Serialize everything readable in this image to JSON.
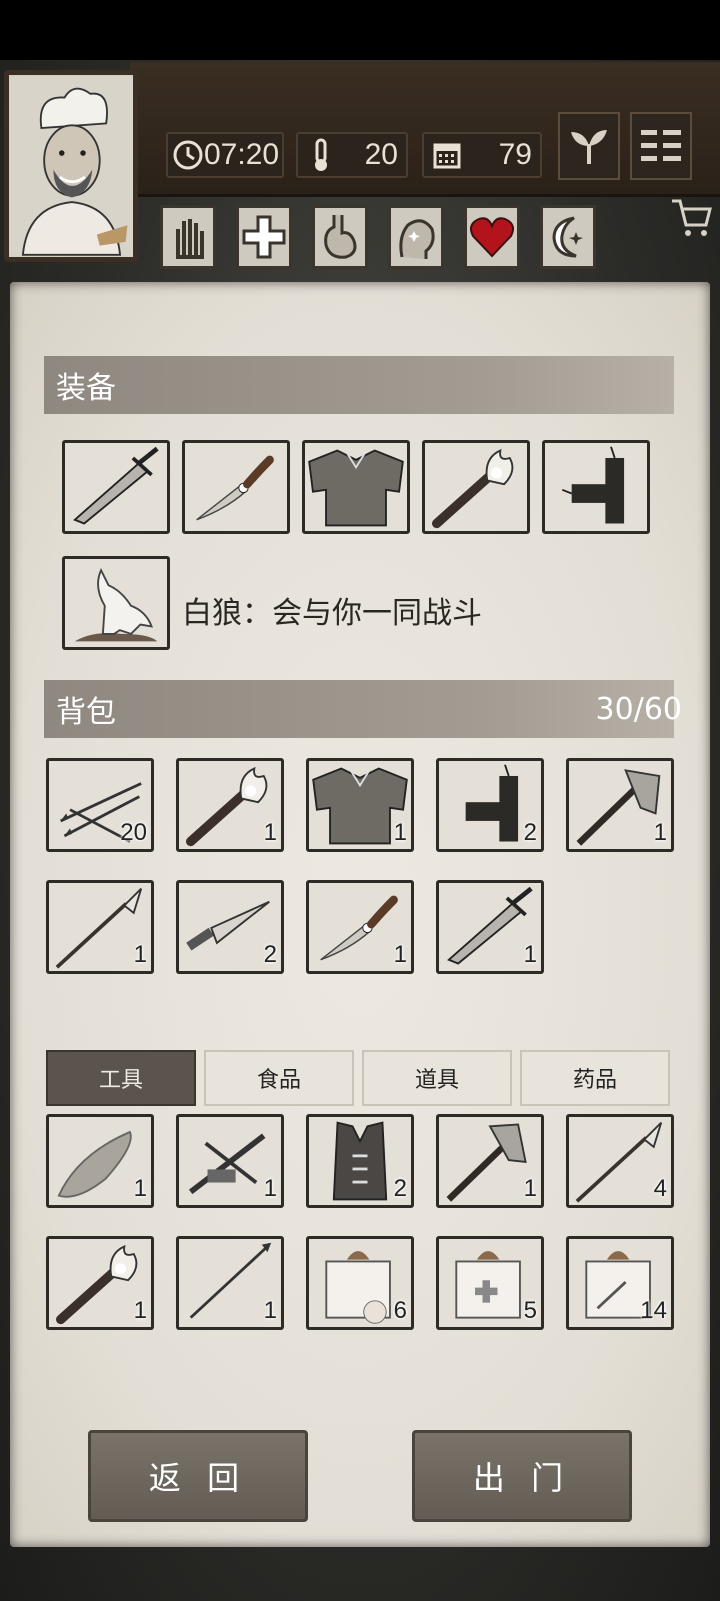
{
  "hud": {
    "time": "07:20",
    "temperature": "20",
    "day": "79",
    "icons": [
      "clock-icon",
      "thermometer-icon",
      "calendar-icon"
    ],
    "actions": [
      "sprout-icon",
      "menu-icon"
    ],
    "status_buttons": [
      "hand-icon",
      "cross-icon",
      "stomach-icon",
      "head-icon",
      "heart-icon",
      "moon-icon"
    ]
  },
  "equipment": {
    "title": "装备",
    "slots": [
      "greatsword",
      "dagger",
      "chainmail",
      "torch",
      "firecracker"
    ],
    "companion": {
      "icon": "white-wolf",
      "text": "白狼：会与你一同战斗"
    }
  },
  "backpack": {
    "title": "背包",
    "count": "30/60",
    "items": [
      {
        "icon": "arrows",
        "qty": "20"
      },
      {
        "icon": "torch",
        "qty": "1"
      },
      {
        "icon": "chainmail",
        "qty": "1"
      },
      {
        "icon": "firecracker",
        "qty": "2"
      },
      {
        "icon": "axe",
        "qty": "1"
      },
      {
        "icon": "spear",
        "qty": "1"
      },
      {
        "icon": "kunai",
        "qty": "2"
      },
      {
        "icon": "dagger",
        "qty": "1"
      },
      {
        "icon": "greatsword",
        "qty": "1"
      }
    ]
  },
  "storage": {
    "tabs": [
      "工具",
      "食品",
      "道具",
      "药品"
    ],
    "active_tab": 0,
    "items": [
      {
        "icon": "stone-knife",
        "qty": "1"
      },
      {
        "icon": "crossbow",
        "qty": "1"
      },
      {
        "icon": "vest",
        "qty": "2"
      },
      {
        "icon": "axe",
        "qty": "1"
      },
      {
        "icon": "spear",
        "qty": "4"
      },
      {
        "icon": "torch",
        "qty": "1"
      },
      {
        "icon": "arrow",
        "qty": "1"
      },
      {
        "icon": "food-box",
        "qty": "6"
      },
      {
        "icon": "medical-box",
        "qty": "5"
      },
      {
        "icon": "weapon-box",
        "qty": "14"
      }
    ]
  },
  "buttons": {
    "back": "返 回",
    "go_out": "出 门"
  },
  "colors": {
    "paper": "#e6e1d8",
    "header": "#9b958c",
    "wood": "#2f261d",
    "active_tab": "#5a544c",
    "heart": "#b3141b"
  }
}
